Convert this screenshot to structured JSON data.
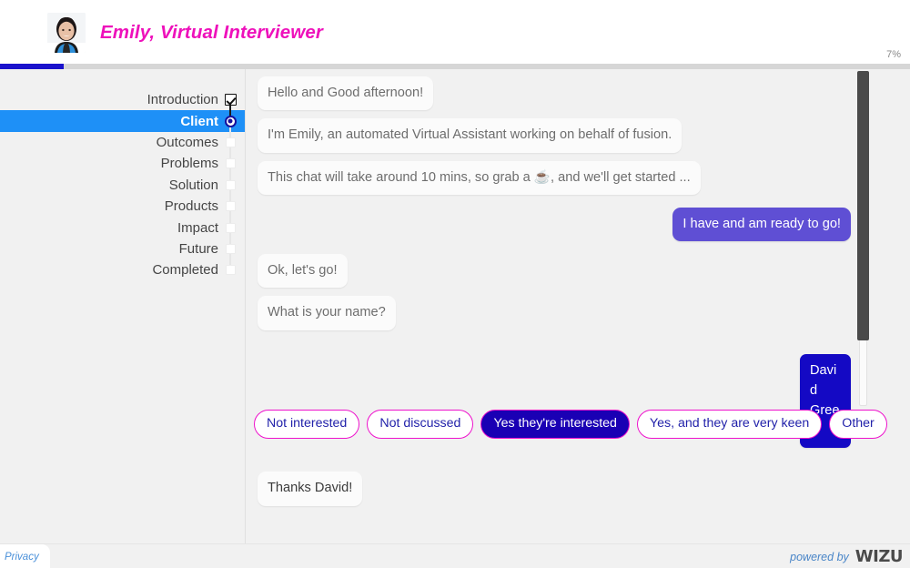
{
  "header": {
    "title": "Emily, Virtual Interviewer",
    "avatar_icon": "user-avatar-photo",
    "title_color": "#ee11bb"
  },
  "progress": {
    "percent_label": "7%",
    "percent_value": 7,
    "fill_color": "#1a12cc"
  },
  "sidebar": {
    "steps": [
      {
        "label": "Introduction",
        "marker": "check",
        "state": "completed"
      },
      {
        "label": "Client",
        "marker": "radio",
        "state": "active"
      },
      {
        "label": "Outcomes",
        "marker": "square",
        "state": "pending"
      },
      {
        "label": "Problems",
        "marker": "square",
        "state": "pending"
      },
      {
        "label": "Solution",
        "marker": "square",
        "state": "pending"
      },
      {
        "label": "Products",
        "marker": "square",
        "state": "pending"
      },
      {
        "label": "Impact",
        "marker": "square",
        "state": "pending"
      },
      {
        "label": "Future",
        "marker": "square",
        "state": "pending"
      },
      {
        "label": "Completed",
        "marker": "square",
        "state": "pending"
      }
    ],
    "active_color": "#1e90f7"
  },
  "chat": {
    "messages": [
      {
        "sender": "bot",
        "text": "Hello and Good afternoon!",
        "tone": "muted"
      },
      {
        "sender": "bot",
        "text": "I'm Emily, an automated Virtual Assistant working on behalf of fusion.",
        "tone": "muted"
      },
      {
        "sender": "bot",
        "text": "This chat will take around 10 mins, so grab a ☕, and we'll get started ...",
        "tone": "muted"
      },
      {
        "sender": "user",
        "text": "I have and am ready to go!",
        "tone": "normal"
      },
      {
        "sender": "bot",
        "text": "Ok, let's go!",
        "tone": "muted"
      },
      {
        "sender": "bot",
        "text": "What is your name?",
        "tone": "muted"
      },
      {
        "sender": "user",
        "text": "David Green",
        "tone": "strong"
      },
      {
        "sender": "bot",
        "text": "Thanks David!",
        "tone": "recent"
      }
    ],
    "user_bubble_color": "#5f4fd4",
    "user_strong_bubble_color": "#1409c4"
  },
  "options": {
    "choices": [
      {
        "label": "Not interested",
        "selected": false
      },
      {
        "label": "Not discussed",
        "selected": false
      },
      {
        "label": "Yes they're interested",
        "selected": true
      },
      {
        "label": "Yes, and they are very keen",
        "selected": false
      },
      {
        "label": "Other",
        "selected": false
      }
    ],
    "border_color": "#ee11cc",
    "selected_fill": "#1a00b4"
  },
  "footer": {
    "privacy_label": "Privacy",
    "powered_by_text": "powered by",
    "brand": "WIZU"
  }
}
